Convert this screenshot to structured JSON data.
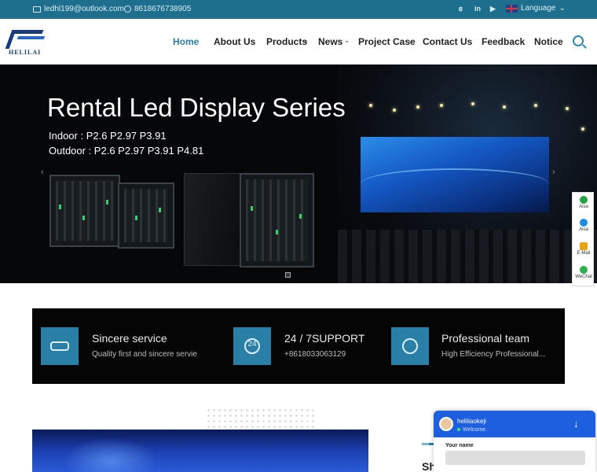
{
  "topbar": {
    "email": "ledhl199@outlook.com",
    "phone": "8618676738905",
    "social": [
      "skype-icon",
      "linkedin-icon",
      "youtube-icon"
    ],
    "social_labels": [
      "ꞩ",
      "in",
      "▶"
    ],
    "language_label": "Language",
    "language_chevron": "⌄"
  },
  "nav": {
    "logo_text": "HELILAI",
    "items": [
      {
        "label": "Home",
        "active": true,
        "dropdown": false
      },
      {
        "label": "About Us",
        "dropdown": false
      },
      {
        "label": "Products",
        "dropdown": true
      },
      {
        "label": "News",
        "dropdown": true
      },
      {
        "label": "Project Case",
        "dropdown": true
      },
      {
        "label": "Contact Us",
        "dropdown": false
      },
      {
        "label": "Feedback",
        "dropdown": false
      },
      {
        "label": "Notice",
        "dropdown": false
      }
    ],
    "chevron": "⌄"
  },
  "hero": {
    "title": "Rental Led Display Series",
    "line1": "Indoor : P2.6 P2.97 P3.91",
    "line2": "Outdoor : P2.6  P2.97 P3.91 P4.81",
    "prev": "‹",
    "next": "›"
  },
  "side_contact": [
    {
      "label": "Aisa",
      "icon": "whatsapp-icon",
      "color": "#25a244"
    },
    {
      "label": "Aisa",
      "icon": "skype-icon",
      "color": "#1d8fe0"
    },
    {
      "label": "E-Mail",
      "icon": "email-icon",
      "color": "#e8a317"
    },
    {
      "label": "WeChat",
      "icon": "wechat-icon",
      "color": "#2bb24c"
    }
  ],
  "features": [
    {
      "title": "Sincere service",
      "subtitle": "Quality first and sincere servie",
      "icon": "handshake-icon"
    },
    {
      "title": "24 / 7SUPPORT",
      "subtitle": "+8618033063129",
      "icon": "clock-24-icon",
      "icon_text": "24"
    },
    {
      "title": "Professional team",
      "subtitle": "High Efficiency Professional...",
      "icon": "atom-icon"
    }
  ],
  "lower": {
    "heading_fragment": "Sh"
  },
  "chat": {
    "agent_name": "heliliaokeji",
    "status": "Welcome.",
    "minimize": "↓",
    "name_label": "Your name",
    "name_value": ""
  }
}
